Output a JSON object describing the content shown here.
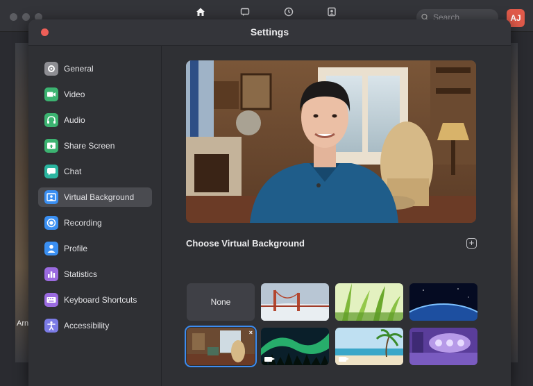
{
  "background_app": {
    "search_placeholder": "Search",
    "avatar_initials": "AJ",
    "left_label": "Arn",
    "top_icons": [
      "home-icon",
      "chat-icon",
      "clock-icon",
      "contacts-icon"
    ]
  },
  "window": {
    "title": "Settings"
  },
  "sidebar": {
    "items": [
      {
        "label": "General",
        "icon": "gear-icon",
        "color": "#8e8e93"
      },
      {
        "label": "Video",
        "icon": "video-icon",
        "color": "#3cb371"
      },
      {
        "label": "Audio",
        "icon": "headphones-icon",
        "color": "#3cb371"
      },
      {
        "label": "Share Screen",
        "icon": "share-screen-icon",
        "color": "#3cb371"
      },
      {
        "label": "Chat",
        "icon": "chat-icon",
        "color": "#2bb5a0"
      },
      {
        "label": "Virtual Background",
        "icon": "person-frame-icon",
        "color": "#3a8ff2"
      },
      {
        "label": "Recording",
        "icon": "record-icon",
        "color": "#3a8ff2"
      },
      {
        "label": "Profile",
        "icon": "profile-icon",
        "color": "#3a8ff2"
      },
      {
        "label": "Statistics",
        "icon": "statistics-icon",
        "color": "#9b6be0"
      },
      {
        "label": "Keyboard Shortcuts",
        "icon": "keyboard-icon",
        "color": "#9b6be0"
      },
      {
        "label": "Accessibility",
        "icon": "accessibility-icon",
        "color": "#7b7be6"
      }
    ],
    "selected_index": 5
  },
  "main": {
    "section_title": "Choose Virtual Background",
    "add_label": "+",
    "backgrounds": [
      {
        "label": "None",
        "kind": "none"
      },
      {
        "label": "",
        "kind": "golden-gate-bridge"
      },
      {
        "label": "",
        "kind": "grass"
      },
      {
        "label": "",
        "kind": "earth-from-space"
      },
      {
        "label": "",
        "kind": "living-room",
        "selected": true,
        "delete_label": "×"
      },
      {
        "label": "",
        "kind": "aurora",
        "video": true
      },
      {
        "label": "",
        "kind": "beach",
        "video": true
      },
      {
        "label": "",
        "kind": "purple-room"
      }
    ]
  },
  "colors": {
    "accent": "#3d8cf0",
    "close": "#ee5f58",
    "avatar": "#e05a4a"
  }
}
